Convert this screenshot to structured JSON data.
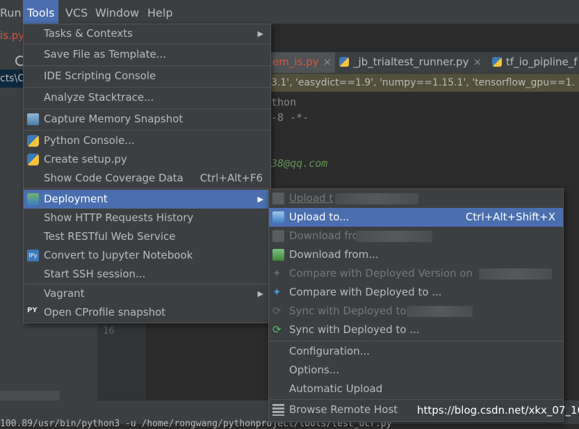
{
  "menubar": {
    "items": [
      {
        "label": "Run"
      },
      {
        "label": "Tools"
      },
      {
        "label": "VCS"
      },
      {
        "label": "Window"
      },
      {
        "label": "Help"
      }
    ]
  },
  "left": {
    "file_tab": "is.py",
    "path_fragment": "cts\\C"
  },
  "editor": {
    "tabs": [
      {
        "label": "em_is.py"
      },
      {
        "label": "_jb_trialtest_runner.py"
      },
      {
        "label": "tf_io_pipline_f"
      }
    ],
    "package_bar": "3.1', 'easydict==1.9', 'numpy==1.15.1', 'tensorflow_gpu==1.",
    "code_lines": [
      "thon",
      "-8 -*-",
      "38@qq.com"
    ],
    "line_number": "16",
    "bottom_text": "100.89/usr/bin/python3 -u /home/rongwang/pythonproject/tools/test_ocr.py"
  },
  "tools_menu": {
    "items": [
      {
        "label": "Tasks & Contexts",
        "has_submenu": true
      },
      {
        "label": "Save File as Template..."
      },
      {
        "label": "IDE Scripting Console"
      },
      {
        "label": "Analyze Stacktrace..."
      },
      {
        "label": "Capture Memory Snapshot",
        "icon": "memory-snapshot-icon"
      },
      {
        "label": "Python Console...",
        "icon": "python-icon"
      },
      {
        "label": "Create setup.py",
        "icon": "python-file-icon"
      },
      {
        "label": "Show Code Coverage Data",
        "shortcut": "Ctrl+Alt+F6"
      },
      {
        "label": "Deployment",
        "icon": "deployment-icon",
        "has_submenu": true,
        "selected": true
      },
      {
        "label": "Show HTTP Requests History"
      },
      {
        "label": "Test RESTful Web Service"
      },
      {
        "label": "Convert to Jupyter Notebook",
        "icon": "jupyter-icon"
      },
      {
        "label": "Start SSH session..."
      },
      {
        "label": "Vagrant",
        "has_submenu": true
      },
      {
        "label": "Open CProfile snapshot",
        "icon": "cprofile-icon"
      }
    ]
  },
  "deployment_menu": {
    "items": [
      {
        "label": "Upload t",
        "disabled": true,
        "icon": "upload-icon"
      },
      {
        "label": "Upload to...",
        "shortcut": "Ctrl+Alt+Shift+X",
        "selected": true,
        "icon": "upload-icon"
      },
      {
        "label": "Download fror",
        "disabled": true,
        "icon": "download-icon"
      },
      {
        "label": "Download from...",
        "icon": "download-icon"
      },
      {
        "label": "Compare with Deployed Version on",
        "disabled": true,
        "icon": "compare-icon"
      },
      {
        "label": "Compare with Deployed to ...",
        "icon": "compare-icon"
      },
      {
        "label": "Sync with Deployed to",
        "disabled": true,
        "icon": "sync-icon"
      },
      {
        "label": "Sync with Deployed to ...",
        "icon": "sync-icon"
      },
      {
        "label": "Configuration..."
      },
      {
        "label": "Options..."
      },
      {
        "label": "Automatic Upload"
      },
      {
        "label": "Browse Remote Host",
        "icon": "remote-host-icon"
      }
    ]
  },
  "watermark": "https://blog.csdn.net/xkx_07_10",
  "colors": {
    "menu_bg": "#3c3f41",
    "selection": "#4b6eaf",
    "editor_bg": "#2b2b2b",
    "error_red": "#e0543f",
    "comment_green": "#629755"
  }
}
